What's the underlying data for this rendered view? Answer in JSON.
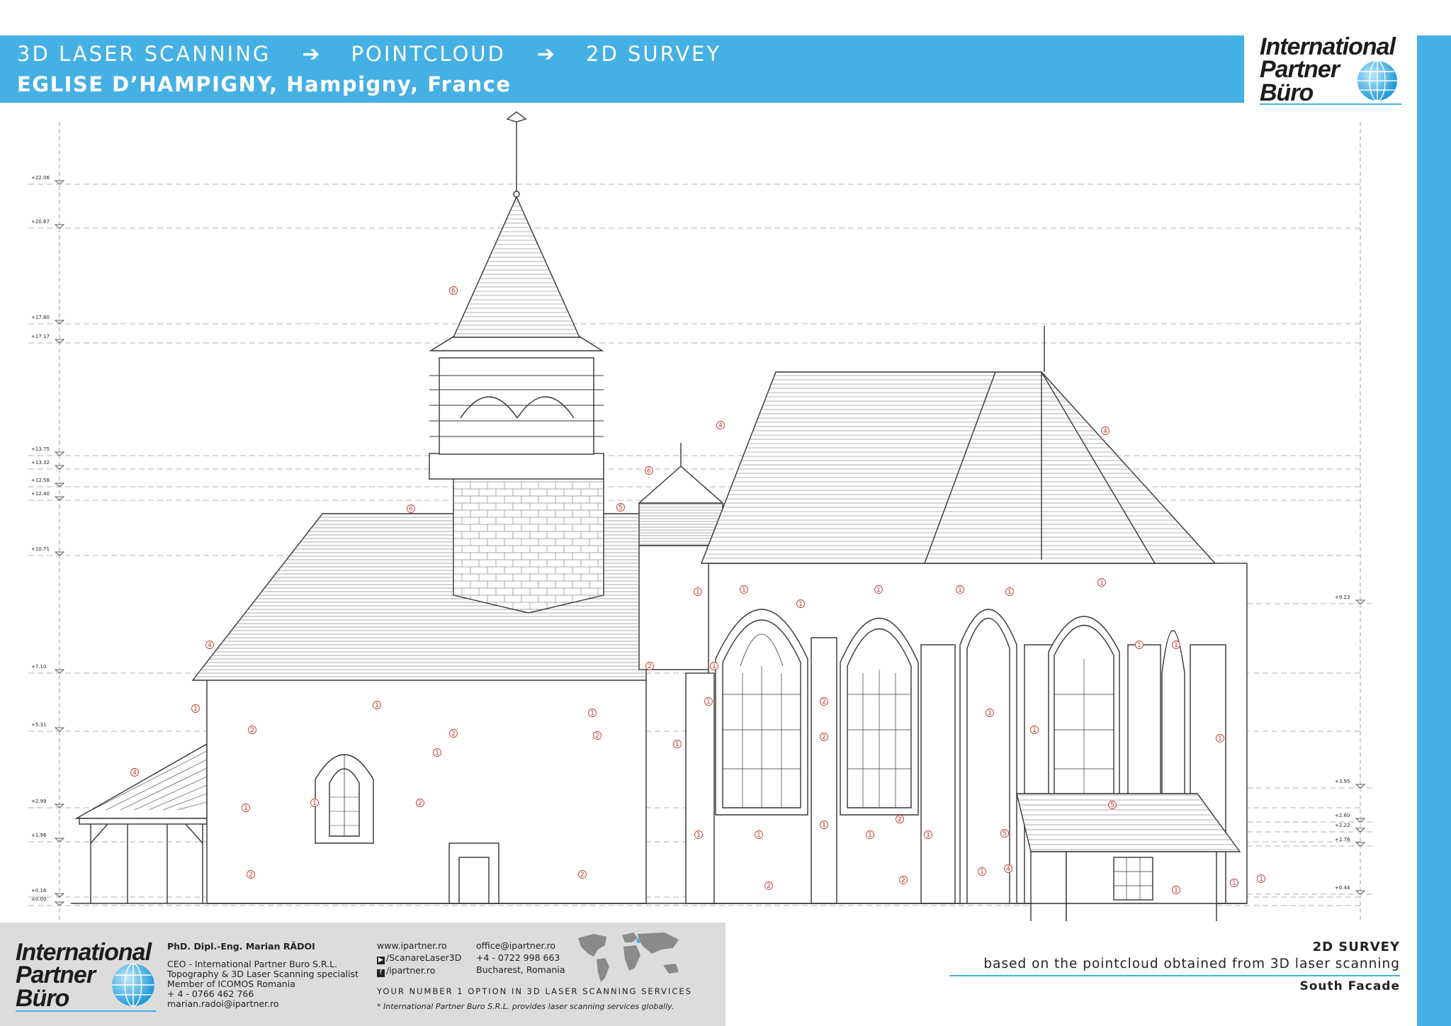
{
  "header": {
    "steps": [
      "3D LASER SCANNING",
      "POINTCLOUD",
      "2D SURVEY"
    ],
    "subtitle": "EGLISE D’HAMPIGNY, Hampigny, France"
  },
  "logo": {
    "line1": "International",
    "line2": "Partner",
    "line3": "Büro"
  },
  "drawing": {
    "levels": [
      "+22.06",
      "+20.67",
      "+17.80",
      "+17.17",
      "+13.75",
      "+13.32",
      "+12.58",
      "+12.40",
      "+10.71",
      "+7.10",
      "+5.31",
      "+2.99",
      "+1.96",
      "+0.16",
      "±0.00"
    ],
    "right_levels": [
      "+9.23",
      "+3.95",
      "+2.60",
      "+2.22",
      "+1.76",
      "+0.44"
    ],
    "markers": [
      "1",
      "2",
      "3",
      "4",
      "5",
      "6"
    ]
  },
  "footer": {
    "name": "PhD. Dipl.-Eng. Marian RĂDOI",
    "title_lines": [
      "CEO - International Partner Buro S.R.L.",
      "Topography & 3D Laser Scanning specialist",
      "Member of ICOMOS Romania",
      "+ 4  - 0766 462 766",
      "marian.radoi@ipartner.ro"
    ],
    "web": "www.ipartner.ro",
    "social_a": "/ScanareLaser3D",
    "social_b": "/ipartner.ro",
    "email": "office@ipartner.ro",
    "phone": "+4 - 0722 998 663",
    "city": "Bucharest, Romania",
    "tagline": "YOUR NUMBER 1 OPTION IN 3D LASER SCANNING SERVICES",
    "note": "* International Partner Buro S.R.L. provides laser scanning services globally."
  },
  "caption": {
    "title": "2D SURVEY",
    "description": "based on the pointcloud obtained from 3D laser scanning",
    "view": "South Facade"
  },
  "colors": {
    "accent": "#45b0e3",
    "line": "#333333",
    "marker": "#c0392b"
  }
}
